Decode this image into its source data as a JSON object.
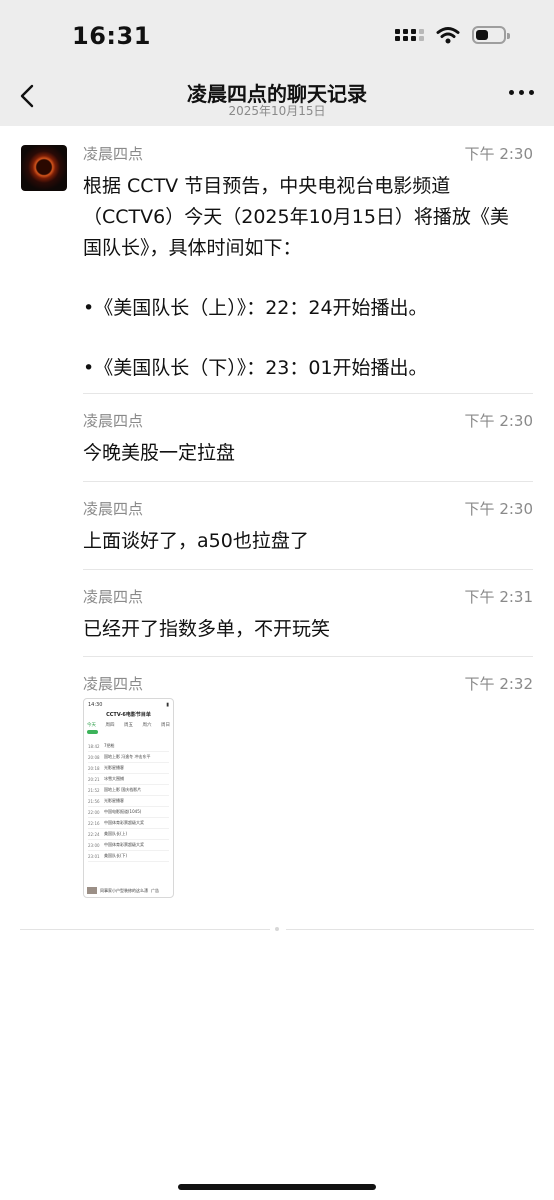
{
  "status_bar": {
    "time": "16:31",
    "icons": [
      "cellular-signal-icon",
      "wifi-icon",
      "battery-icon"
    ]
  },
  "nav": {
    "back_icon": "chevron-left-icon",
    "title": "凌晨四点的聊天记录",
    "subtitle": "2025年10月15日",
    "more_icon": "more-dots-icon"
  },
  "messages": [
    {
      "sender": "凌晨四点",
      "time": "下午 2:30",
      "lines": [
        "根据 CCTV 节目预告，中央电视台电影频道",
        "（CCTV6）今天（2025年10月15日）将播放《美",
        "国队长》，具体时间如下：",
        "",
        "•《美国队长（上）》：22：24开始播出。",
        "",
        "•《美国队长（下）》：23：01开始播出。"
      ]
    },
    {
      "sender": "凌晨四点",
      "time": "下午 2:30",
      "text": "今晚美股一定拉盘"
    },
    {
      "sender": "凌晨四点",
      "time": "下午 2:30",
      "text": "上面谈好了，a50也拉盘了"
    },
    {
      "sender": "凌晨四点",
      "time": "下午 2:31",
      "text": "已经开了指数多单，不开玩笑"
    },
    {
      "sender": "凌晨四点",
      "time": "下午 2:32",
      "image": "tv-schedule-screenshot"
    }
  ],
  "thumbnail": {
    "time": "14:30",
    "title": "CCTV-6电影节目单",
    "tabs": [
      "今天",
      "周四",
      "周五",
      "周六",
      "周日"
    ],
    "rows": [
      {
        "time": "18:42",
        "title": "7把枪"
      },
      {
        "time": "20:08",
        "title": "国地上影 冯逸冬 冲击东平"
      },
      {
        "time": "20:18",
        "title": "光影星播客"
      },
      {
        "time": "20:21",
        "title": "冰雪大围捕"
      },
      {
        "time": "21:52",
        "title": "国地上影 国庆档影片"
      },
      {
        "time": "21:56",
        "title": "光影星播客"
      },
      {
        "time": "22:00",
        "title": "中国电影报道(1045)"
      },
      {
        "time": "22:16",
        "title": "中国体育彩票超级大奖"
      },
      {
        "time": "22:24",
        "title": "美国队长(上)"
      },
      {
        "time": "23:00",
        "title": "中国体育彩票超级大奖"
      },
      {
        "time": "23:01",
        "title": "美国队长(下)"
      }
    ],
    "ad_text": "同事家小户型装修的这么漂",
    "ad_badge": "广告"
  }
}
